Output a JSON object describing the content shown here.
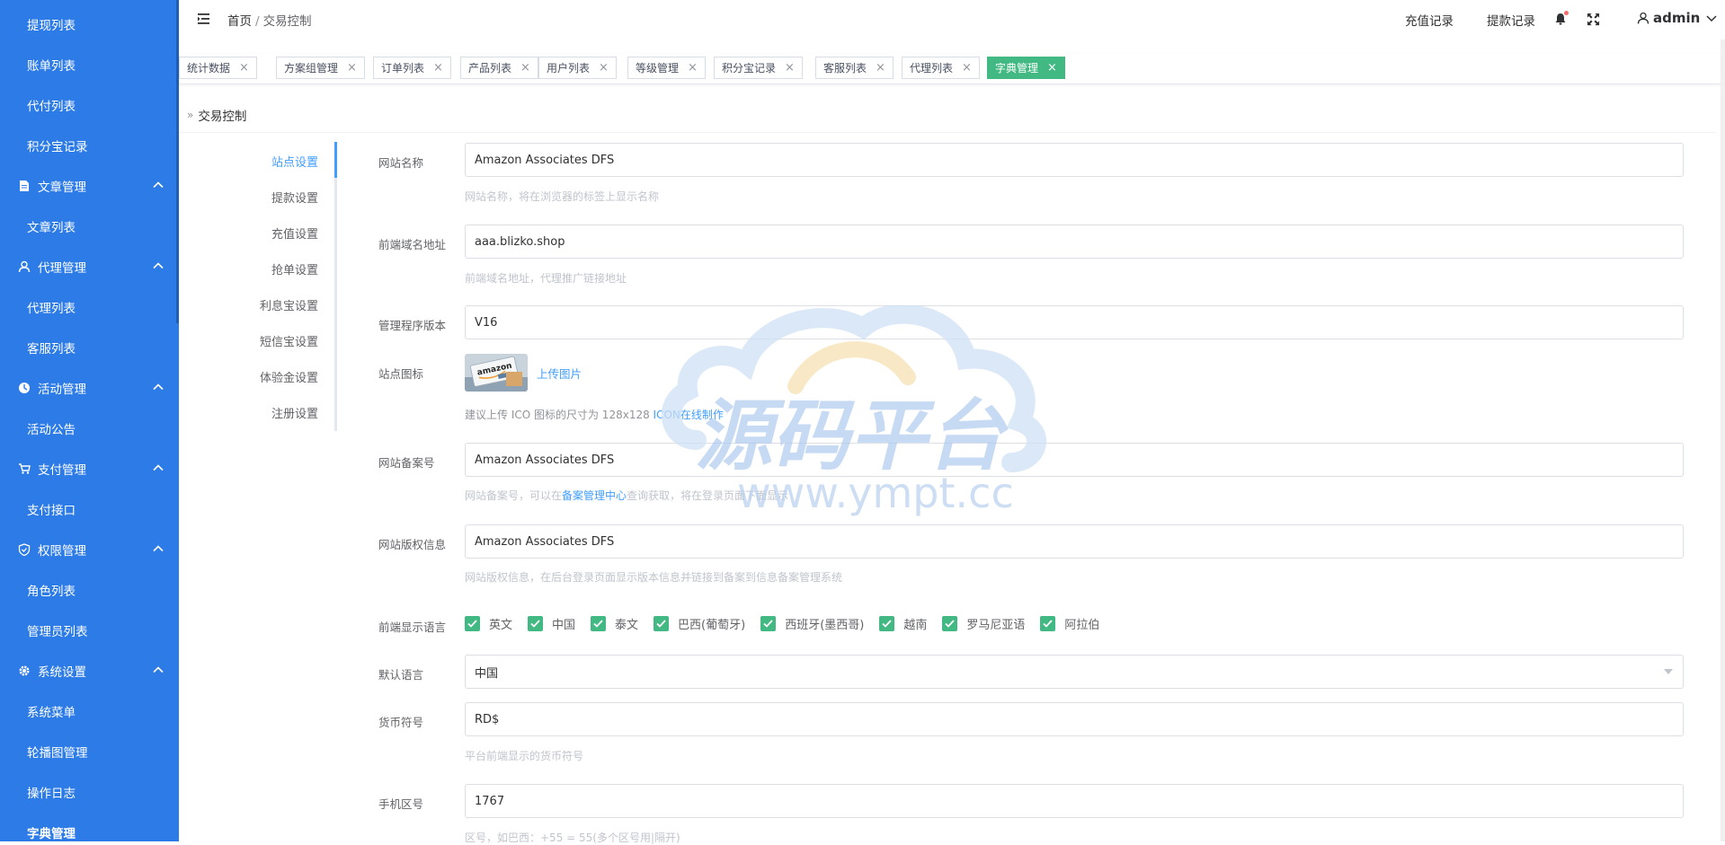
{
  "sidebar": {
    "items": [
      {
        "type": "sub",
        "label": "提现列表"
      },
      {
        "type": "sub",
        "label": "账单列表"
      },
      {
        "type": "sub",
        "label": "代付列表"
      },
      {
        "type": "sub",
        "label": "积分宝记录"
      },
      {
        "type": "group",
        "label": "文章管理",
        "icon": "document-icon"
      },
      {
        "type": "sub",
        "label": "文章列表"
      },
      {
        "type": "group",
        "label": "代理管理",
        "icon": "user-icon"
      },
      {
        "type": "sub",
        "label": "代理列表"
      },
      {
        "type": "sub",
        "label": "客服列表"
      },
      {
        "type": "group",
        "label": "活动管理",
        "icon": "activity-icon"
      },
      {
        "type": "sub",
        "label": "活动公告"
      },
      {
        "type": "group",
        "label": "支付管理",
        "icon": "cart-icon"
      },
      {
        "type": "sub",
        "label": "支付接口"
      },
      {
        "type": "group",
        "label": "权限管理",
        "icon": "shield-icon"
      },
      {
        "type": "sub",
        "label": "角色列表"
      },
      {
        "type": "sub",
        "label": "管理员列表"
      },
      {
        "type": "group",
        "label": "系统设置",
        "icon": "gear-icon"
      },
      {
        "type": "sub",
        "label": "系统菜单"
      },
      {
        "type": "sub",
        "label": "轮播图管理"
      },
      {
        "type": "sub",
        "label": "操作日志"
      },
      {
        "type": "sub",
        "label": "字典管理",
        "active": true
      }
    ]
  },
  "header": {
    "breadcrumb_home": "首页",
    "breadcrumb_sep": "/",
    "breadcrumb_current": "交易控制",
    "recharge_label": "充值记录",
    "withdraw_label": "提款记录",
    "user_label": "admin"
  },
  "tabs": [
    {
      "label": "统计数据"
    },
    {
      "label": "方案组管理"
    },
    {
      "label": "订单列表"
    },
    {
      "label": "产品列表"
    },
    {
      "label": "用户列表"
    },
    {
      "label": "等级管理"
    },
    {
      "label": "积分宝记录"
    },
    {
      "label": "客服列表"
    },
    {
      "label": "代理列表"
    },
    {
      "label": "字典管理",
      "active": true
    }
  ],
  "tab_close": "×",
  "page": {
    "title_prefix": "»",
    "title": "交易控制"
  },
  "settings_menu": [
    {
      "label": "站点设置",
      "active": true
    },
    {
      "label": "提款设置"
    },
    {
      "label": "充值设置"
    },
    {
      "label": "抢单设置"
    },
    {
      "label": "利息宝设置"
    },
    {
      "label": "短信宝设置"
    },
    {
      "label": "体验金设置"
    },
    {
      "label": "注册设置"
    }
  ],
  "form": {
    "site_name": {
      "label": "网站名称",
      "value": "Amazon Associates DFS",
      "hint": "网站名称，将在浏览器的标签上显示名称"
    },
    "frontend_domain": {
      "label": "前端域名地址",
      "value": "aaa.blizko.shop",
      "hint": "前端域名地址，代理推广链接地址"
    },
    "admin_version": {
      "label": "管理程序版本",
      "value": "V16"
    },
    "site_icon": {
      "label": "站点图标",
      "upload_label": "上传图片",
      "hint_prefix": "建议上传 ICO 图标的尺寸为 128x128",
      "hint_link": "ICON在线制作",
      "thumb_text": "amazon"
    },
    "icp": {
      "label": "网站备案号",
      "value": "Amazon Associates DFS",
      "hint_prefix": "网站备案号，可以在",
      "hint_link": "备案管理中心",
      "hint_suffix": "查询获取，将在登录页面下面显示"
    },
    "copyright": {
      "label": "网站版权信息",
      "value": "Amazon Associates DFS",
      "hint": "网站版权信息，在后台登录页面显示版本信息并链接到备案到信息备案管理系统"
    },
    "languages": {
      "label": "前端显示语言",
      "options": [
        "英文",
        "中国",
        "泰文",
        "巴西(葡萄牙)",
        "西班牙(墨西哥)",
        "越南",
        "罗马尼亚语",
        "阿拉伯"
      ]
    },
    "default_language": {
      "label": "默认语言",
      "value": "中国"
    },
    "currency": {
      "label": "货币符号",
      "value": "RD$",
      "hint": "平台前端显示的货币符号"
    },
    "phone_code": {
      "label": "手机区号",
      "value": "1767",
      "hint": "区号，如巴西：+55 = 55(多个区号用|隔开)"
    }
  },
  "watermark": {
    "text_cn": "源码平台",
    "text_url": "www.ympt.cc"
  },
  "colors": {
    "sidebar": "#2d7be6",
    "accent": "#409eff",
    "tab_active": "#42b983",
    "checkbox": "#42b983"
  }
}
